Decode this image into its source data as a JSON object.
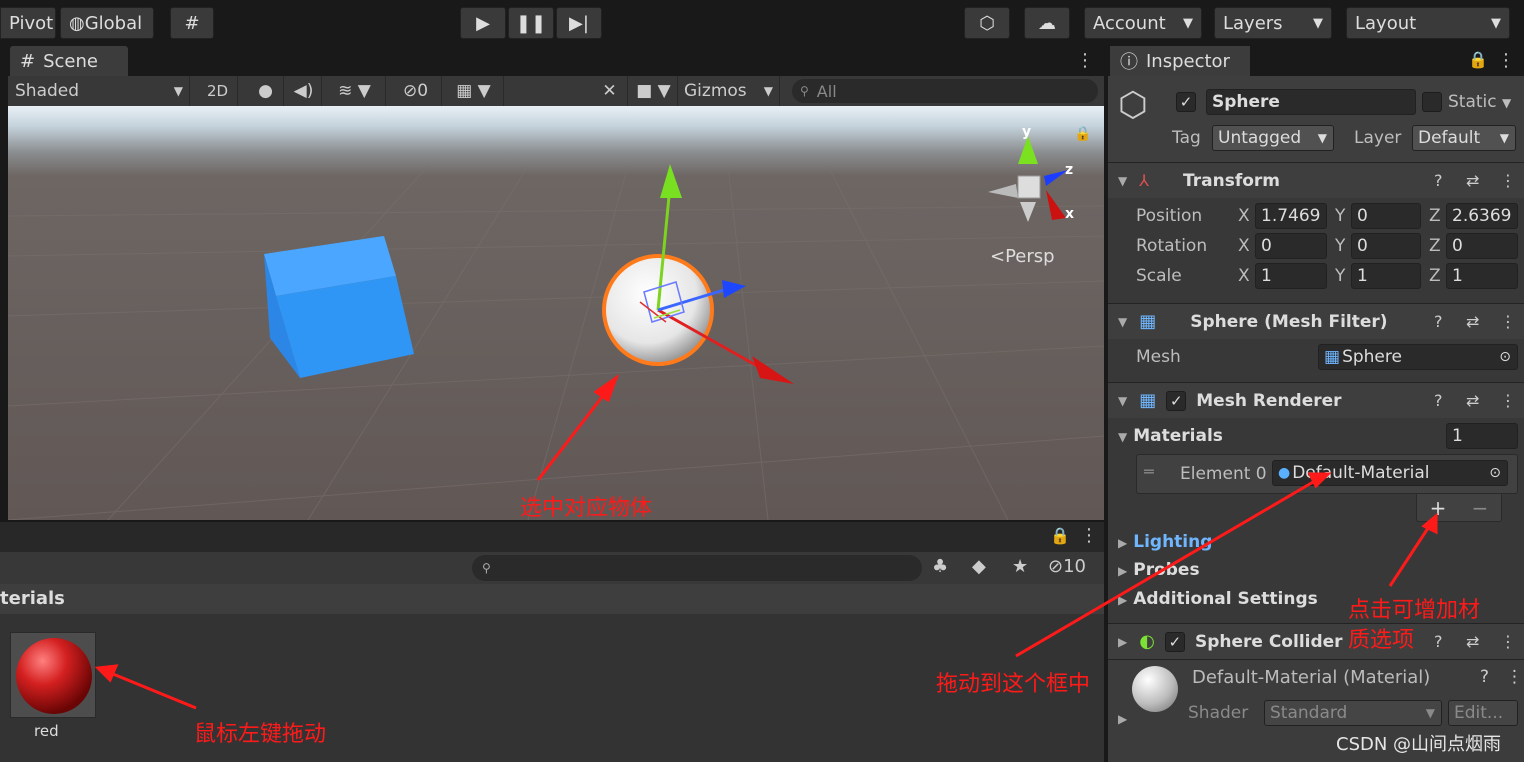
{
  "toolbar": {
    "pivot": "Pivot",
    "global": "Global",
    "account": "Account",
    "layers": "Layers",
    "layout": "Layout"
  },
  "scene": {
    "tab": "Scene",
    "shading": "Shaded",
    "mode_2d": "2D",
    "hidden_count": "0",
    "gizmos": "Gizmos",
    "search_placeholder": "All",
    "persp": "Persp",
    "axis_y": "y",
    "axis_z": "z",
    "axis_x": "x"
  },
  "project": {
    "hidden_count": "10",
    "crumb": "terials",
    "asset_name": "red"
  },
  "inspector": {
    "tab": "Inspector",
    "object_name": "Sphere",
    "static_label": "Static",
    "tag_label": "Tag",
    "tag_value": "Untagged",
    "layer_label": "Layer",
    "layer_value": "Default",
    "transform": {
      "title": "Transform",
      "position_label": "Position",
      "rotation_label": "Rotation",
      "scale_label": "Scale",
      "position": {
        "x": "1.7469",
        "y": "0",
        "z": "2.6369"
      },
      "rotation": {
        "x": "0",
        "y": "0",
        "z": "0"
      },
      "scale": {
        "x": "1",
        "y": "1",
        "z": "1"
      }
    },
    "mesh_filter": {
      "title": "Sphere (Mesh Filter)",
      "mesh_label": "Mesh",
      "mesh_value": "Sphere"
    },
    "mesh_renderer": {
      "title": "Mesh Renderer",
      "materials_label": "Materials",
      "materials_count": "1",
      "element_label": "Element 0",
      "element_value": "Default-Material",
      "lighting": "Lighting",
      "probes": "Probes",
      "additional": "Additional Settings"
    },
    "sphere_collider": {
      "title": "Sphere Collider"
    },
    "material": {
      "title": "Default-Material (Material)",
      "shader_label": "Shader",
      "shader_value": "Standard",
      "edit": "Edit..."
    }
  },
  "annotations": {
    "select_object": "选中对应物体",
    "drag_left": "鼠标左键拖动",
    "drag_into": "拖动到这个框中",
    "add_material_1": "点击可增加材",
    "add_material_2": "质选项"
  },
  "watermark": "CSDN @山间点烟雨"
}
